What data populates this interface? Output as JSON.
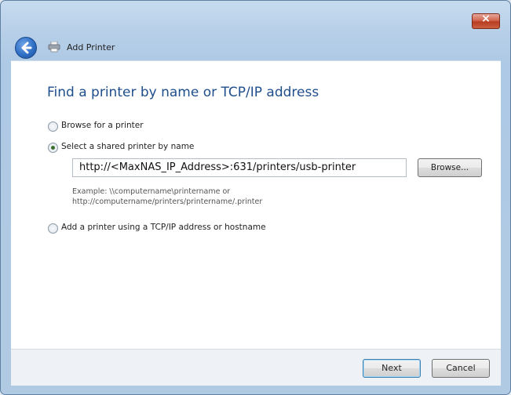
{
  "window": {
    "close_label": "×",
    "title": "Add Printer"
  },
  "heading": "Find a printer by name or TCP/IP address",
  "options": [
    {
      "label": "Browse for a printer",
      "checked": false
    },
    {
      "label": "Select a shared printer by name",
      "checked": true
    },
    {
      "label": "Add a printer using a TCP/IP address or hostname",
      "checked": false
    }
  ],
  "shared_printer": {
    "value": "http://<MaxNAS_IP_Address>:631/printers/usb-printer",
    "browse_label": "Browse...",
    "example_line1": "Example: \\\\computername\\printername or",
    "example_line2": "http://computername/printers/printername/.printer"
  },
  "footer": {
    "next_label": "Next",
    "cancel_label": "Cancel"
  }
}
